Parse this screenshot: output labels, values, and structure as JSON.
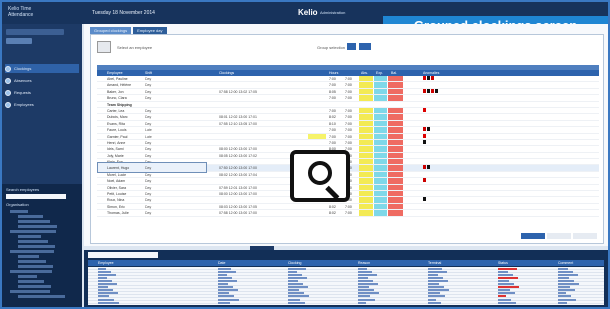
{
  "app": {
    "logo_line1": "Kelio Time",
    "logo_line2": "Attendance",
    "date": "Tuesday 18 November 2014",
    "brand": "Kelio",
    "brand_sub": "Administration"
  },
  "callout": "Grouped clockings screen",
  "sidebar": {
    "nav": [
      {
        "label": "Clockings",
        "icon": "clock-icon",
        "active": true
      },
      {
        "label": "Absences",
        "icon": "calendar-icon",
        "active": false
      },
      {
        "label": "Requests",
        "icon": "inbox-icon",
        "active": false
      },
      {
        "label": "Employees",
        "icon": "people-icon",
        "active": false
      }
    ],
    "lower_title": "Search employees",
    "tree_title": "Organisation"
  },
  "main": {
    "tabs": [
      "Grouped clockings",
      "Employee day"
    ],
    "employee_hint": "Select an employee",
    "ctrl_text": "Group selection"
  },
  "grid": {
    "headers": [
      "Employee",
      "Shift",
      "Clockings",
      "Hours",
      "Abs.",
      "Exp.",
      "Bal.",
      "Anomalies"
    ],
    "rows": [
      {
        "name": "Abel, Pauline",
        "shift": "Day",
        "times": "",
        "c1": "7:00",
        "c2": "7:00",
        "flags": [
          "#d00",
          "#111",
          "#c00"
        ]
      },
      {
        "name": "Amand, Hélène",
        "shift": "Day",
        "times": "",
        "c1": "7:00",
        "c2": "7:00",
        "flags": []
      },
      {
        "name": "Baker, Jon",
        "shift": "Day",
        "times": "07:58 12:00 13:02 17:05",
        "c1": "8:05",
        "c2": "7:00",
        "flags": [
          "#c00",
          "#111",
          "#c00",
          "#111"
        ]
      },
      {
        "name": "Bruno, Clara",
        "shift": "Day",
        "times": "",
        "c1": "7:00",
        "c2": "7:00",
        "flags": []
      },
      {
        "name": "Team Shipping",
        "shift": "",
        "times": "",
        "c1": "",
        "c2": "",
        "group": true,
        "flags": []
      },
      {
        "name": "Carter, Lea",
        "shift": "Day",
        "times": "",
        "c1": "7:00",
        "c2": "7:00",
        "flags": [
          "#d00"
        ]
      },
      {
        "name": "Dubois, Marc",
        "shift": "Day",
        "times": "08:01 12:02 13:00 17:01",
        "c1": "8:02",
        "c2": "7:00",
        "flags": []
      },
      {
        "name": "Evans, Rita",
        "shift": "Day",
        "times": "07:55 12:10 13:05 17:00",
        "c1": "8:10",
        "c2": "7:00",
        "flags": []
      },
      {
        "name": "Faure, Louis",
        "shift": "Late",
        "times": "",
        "c1": "7:00",
        "c2": "7:00",
        "flags": [
          "#c00",
          "#111"
        ]
      },
      {
        "name": "Garnier, Paul",
        "shift": "Late",
        "times": "",
        "c1": "7:00",
        "c2": "7:00",
        "flags": [
          "#d00"
        ],
        "hl": true
      },
      {
        "name": "Henri, Anne",
        "shift": "Day",
        "times": "",
        "c1": "7:00",
        "c2": "7:00",
        "flags": [
          "#111"
        ]
      },
      {
        "name": "Idris, Sami",
        "shift": "Day",
        "times": "08:00 12:00 13:00 17:00",
        "c1": "8:00",
        "c2": "7:00",
        "flags": []
      },
      {
        "name": "Joly, Marie",
        "shift": "Day",
        "times": "08:05 12:00 13:00 17:02",
        "c1": "7:57",
        "c2": "7:00",
        "flags": []
      },
      {
        "name": "Klein, Eva",
        "shift": "Day",
        "times": "",
        "c1": "7:00",
        "c2": "7:00",
        "flags": []
      },
      {
        "name": "Laurent, Hugo",
        "shift": "Day",
        "times": "07:50 12:00 13:00 17:00",
        "c1": "8:10",
        "c2": "7:00",
        "flags": [
          "#c00",
          "#111"
        ],
        "selected": true
      },
      {
        "name": "Morel, Lucie",
        "shift": "Day",
        "times": "08:02 12:00 13:00 17:04",
        "c1": "8:02",
        "c2": "7:00",
        "flags": []
      },
      {
        "name": "Noel, Adam",
        "shift": "Day",
        "times": "",
        "c1": "7:00",
        "c2": "7:00",
        "flags": [
          "#c00"
        ]
      },
      {
        "name": "Olivier, Sara",
        "shift": "Day",
        "times": "07:59 12:01 13:00 17:00",
        "c1": "8:02",
        "c2": "7:00",
        "flags": []
      },
      {
        "name": "Petit, Louise",
        "shift": "Day",
        "times": "08:00 12:00 13:00 17:00",
        "c1": "8:00",
        "c2": "7:00",
        "flags": []
      },
      {
        "name": "Roux, Nina",
        "shift": "Day",
        "times": "",
        "c1": "7:00",
        "c2": "7:00",
        "flags": [
          "#111"
        ]
      },
      {
        "name": "Simon, Eric",
        "shift": "Day",
        "times": "08:03 12:00 13:00 17:05",
        "c1": "8:02",
        "c2": "7:00",
        "flags": []
      },
      {
        "name": "Thomas, Julie",
        "shift": "Day",
        "times": "07:58 12:00 13:00 17:00",
        "c1": "8:02",
        "c2": "7:00",
        "flags": []
      }
    ]
  },
  "bottom": {
    "headers": [
      "Employee",
      "Date",
      "Clocking",
      "Reason",
      "Terminal",
      "Status",
      "Comment"
    ],
    "rows": 12
  },
  "icons": {
    "magnifier": "magnifier-icon"
  }
}
